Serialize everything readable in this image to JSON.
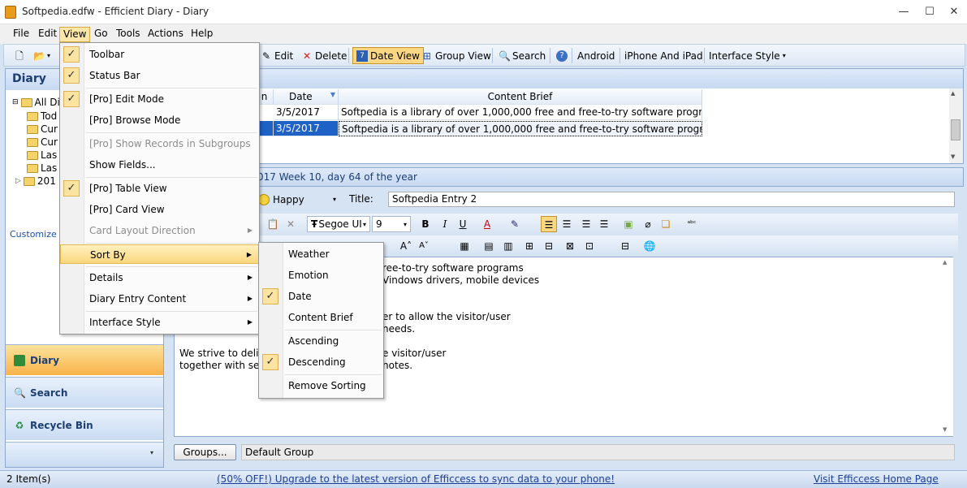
{
  "window": {
    "title": "Softpedia.edfw - Efficient Diary - Diary",
    "controls": {
      "minimize": "—",
      "maximize": "☐",
      "close": "✕"
    }
  },
  "menubar": [
    "File",
    "Edit",
    "View",
    "Go",
    "Tools",
    "Actions",
    "Help"
  ],
  "toolbar": {
    "edit": "Edit",
    "delete": "Delete",
    "date_view": "Date View",
    "group_view": "Group View",
    "search": "Search",
    "android": "Android",
    "iphone": "iPhone And iPad",
    "interface_style": "Interface Style"
  },
  "left_panel": {
    "title": "Diary",
    "tree": [
      "All Diar",
      "Tod",
      "Cur",
      "Cur",
      "Las",
      "Las",
      "201"
    ],
    "customize": "Customize C",
    "nav": [
      {
        "label": "Diary",
        "active": true
      },
      {
        "label": "Search",
        "active": false
      },
      {
        "label": "Recycle Bin",
        "active": false
      }
    ]
  },
  "grid": {
    "columns": [
      "n",
      "Date",
      "Content Brief"
    ],
    "rows": [
      {
        "date": "3/5/2017",
        "brief": "Softpedia is a library of over 1,000,000 free and free-to-try software programs"
      },
      {
        "date": "3/5/2017",
        "brief": "Softpedia is a library of over 1,000,000 free and free-to-try software programs"
      }
    ]
  },
  "date_header": "017   Week 10, day 64 of the year",
  "entry": {
    "emotion": "Happy",
    "title_label": "Title:",
    "title_value": "Softpedia Entry 2",
    "font": "Segoe UI",
    "size": "9"
  },
  "editor_lines": [
    "ree-to-try software programs",
    "Vindows drivers, mobile devices",
    "",
    "er to allow the visitor/user",
    "needs.",
    "",
    "We strive to delive",
    "together with self-"
  ],
  "editor_lines_right": [
    "e visitor/user",
    "notes."
  ],
  "groups": {
    "button": "Groups...",
    "value": "Default Group"
  },
  "status": {
    "items": "2 Item(s)",
    "promo": "(50% OFF!) Upgrade to the latest version of Efficcess to sync data to your phone!",
    "visit": "Visit Efficcess Home Page"
  },
  "view_menu": [
    {
      "label": "Toolbar",
      "checked": true
    },
    {
      "label": "Status Bar",
      "checked": true
    },
    {
      "label": "[Pro] Edit Mode",
      "checked": true
    },
    {
      "label": "[Pro] Browse Mode",
      "checked": false
    },
    {
      "label": "[Pro] Show Records in Subgroups",
      "checked": false,
      "disabled": true
    },
    {
      "label": "Show Fields...",
      "checked": false
    },
    {
      "label": "[Pro] Table View",
      "checked": true
    },
    {
      "label": "[Pro] Card View",
      "checked": false
    },
    {
      "label": "Card Layout Direction",
      "checked": false,
      "disabled": true,
      "submenu": true
    },
    {
      "label": "Sort By",
      "checked": false,
      "submenu": true,
      "highlighted": true
    },
    {
      "label": "Details",
      "checked": false,
      "submenu": true
    },
    {
      "label": "Diary Entry Content",
      "checked": false,
      "submenu": true
    },
    {
      "label": "Interface Style",
      "checked": false,
      "submenu": true
    }
  ],
  "sort_menu": [
    {
      "label": "Weather",
      "checked": false
    },
    {
      "label": "Emotion",
      "checked": false
    },
    {
      "label": "Date",
      "checked": true
    },
    {
      "label": "Content Brief",
      "checked": false
    },
    {
      "label": "Ascending",
      "checked": false
    },
    {
      "label": "Descending",
      "checked": true
    },
    {
      "label": "Remove Sorting",
      "checked": false
    }
  ]
}
